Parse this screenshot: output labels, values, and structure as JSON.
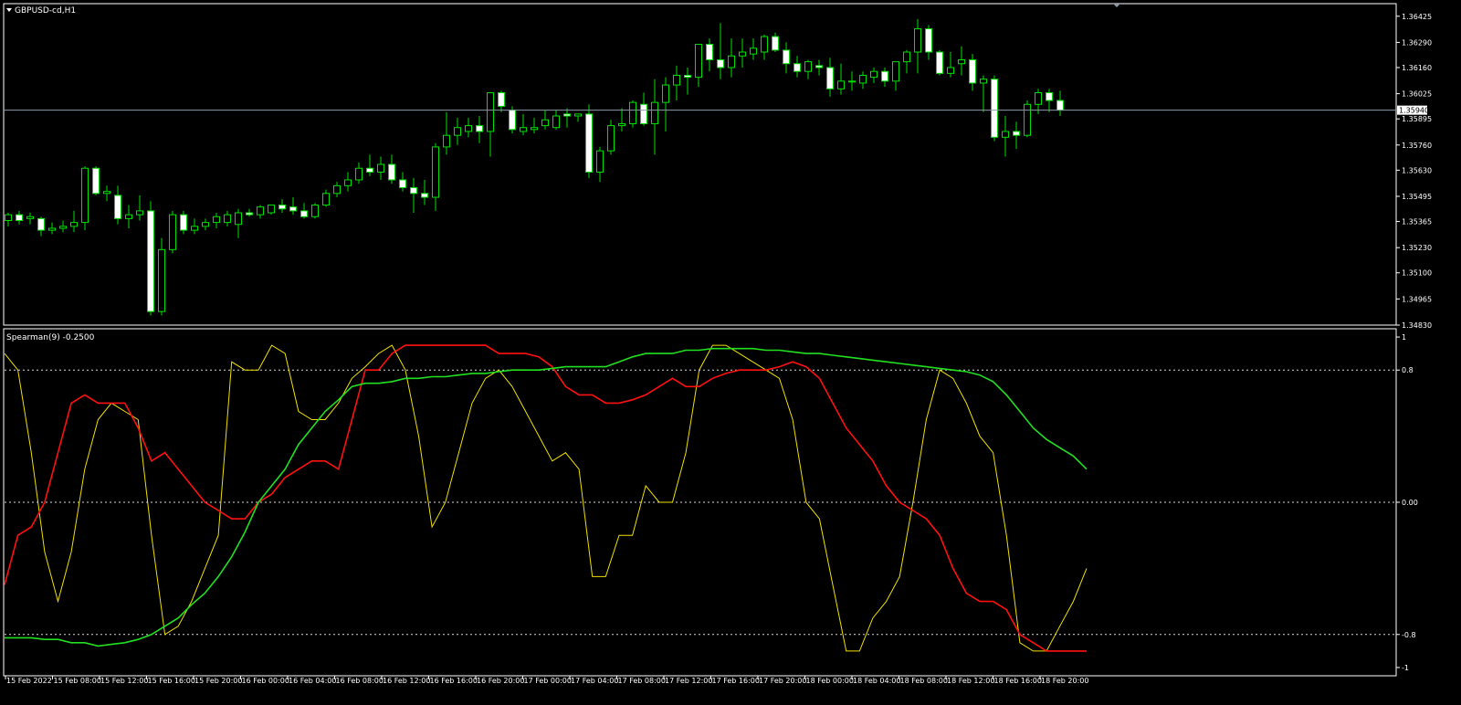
{
  "chart_data": [
    {
      "type": "candlestick",
      "title": "GBPUSD-cd,H1",
      "ylim": [
        1.3483,
        1.3649
      ],
      "y_ticks": [
        "1.36425",
        "1.36290",
        "1.36160",
        "1.36025",
        "1.35895",
        "1.35760",
        "1.35630",
        "1.35495",
        "1.35365",
        "1.35230",
        "1.35100",
        "1.34965",
        "1.34830"
      ],
      "current_price": 1.3594,
      "current_price_label": "1.35940",
      "candles": [
        [
          1.3537,
          1.3541,
          1.3534,
          1.354
        ],
        [
          1.354,
          1.3542,
          1.3535,
          1.3537
        ],
        [
          1.3538,
          1.3541,
          1.3535,
          1.3539
        ],
        [
          1.3538,
          1.3539,
          1.3529,
          1.3532
        ],
        [
          1.3532,
          1.3536,
          1.353,
          1.3533
        ],
        [
          1.3533,
          1.3537,
          1.3531,
          1.3534
        ],
        [
          1.3534,
          1.3542,
          1.3531,
          1.3536
        ],
        [
          1.3536,
          1.3565,
          1.3532,
          1.3564
        ],
        [
          1.3564,
          1.3565,
          1.355,
          1.3551
        ],
        [
          1.3551,
          1.3555,
          1.3547,
          1.3552
        ],
        [
          1.355,
          1.3555,
          1.3535,
          1.3538
        ],
        [
          1.3538,
          1.3545,
          1.3533,
          1.354
        ],
        [
          1.354,
          1.355,
          1.3537,
          1.3542
        ],
        [
          1.3542,
          1.3547,
          1.3488,
          1.349
        ],
        [
          1.349,
          1.3528,
          1.3488,
          1.3522
        ],
        [
          1.3522,
          1.3542,
          1.352,
          1.354
        ],
        [
          1.354,
          1.3542,
          1.353,
          1.3532
        ],
        [
          1.3532,
          1.3538,
          1.353,
          1.3534
        ],
        [
          1.3534,
          1.3538,
          1.3532,
          1.3536
        ],
        [
          1.3536,
          1.3541,
          1.3533,
          1.3539
        ],
        [
          1.3536,
          1.3542,
          1.3534,
          1.354
        ],
        [
          1.3535,
          1.3543,
          1.3528,
          1.3541
        ],
        [
          1.3541,
          1.3543,
          1.3539,
          1.354
        ],
        [
          1.354,
          1.3545,
          1.3538,
          1.3544
        ],
        [
          1.3541,
          1.3545,
          1.354,
          1.3545
        ],
        [
          1.3545,
          1.3548,
          1.3541,
          1.3543
        ],
        [
          1.3544,
          1.3549,
          1.354,
          1.3542
        ],
        [
          1.3542,
          1.3546,
          1.3538,
          1.3539
        ],
        [
          1.3539,
          1.3546,
          1.3538,
          1.3545
        ],
        [
          1.3545,
          1.3553,
          1.3544,
          1.3551
        ],
        [
          1.3551,
          1.3557,
          1.3549,
          1.3555
        ],
        [
          1.3555,
          1.3562,
          1.3552,
          1.3558
        ],
        [
          1.3558,
          1.3567,
          1.3556,
          1.3564
        ],
        [
          1.3564,
          1.3571,
          1.356,
          1.3562
        ],
        [
          1.3562,
          1.357,
          1.3558,
          1.3566
        ],
        [
          1.3566,
          1.3571,
          1.3556,
          1.3558
        ],
        [
          1.3558,
          1.3562,
          1.3552,
          1.3554
        ],
        [
          1.3554,
          1.3559,
          1.3541,
          1.3551
        ],
        [
          1.3551,
          1.3558,
          1.3545,
          1.3549
        ],
        [
          1.3549,
          1.3577,
          1.3542,
          1.3575
        ],
        [
          1.3575,
          1.3593,
          1.3571,
          1.3581
        ],
        [
          1.3581,
          1.359,
          1.3576,
          1.3585
        ],
        [
          1.3583,
          1.359,
          1.358,
          1.3586
        ],
        [
          1.3586,
          1.3591,
          1.3577,
          1.3583
        ],
        [
          1.3583,
          1.3597,
          1.357,
          1.3603
        ],
        [
          1.3603,
          1.3604,
          1.3593,
          1.3596
        ],
        [
          1.3594,
          1.3596,
          1.3582,
          1.3584
        ],
        [
          1.3583,
          1.3592,
          1.3581,
          1.3585
        ],
        [
          1.3584,
          1.359,
          1.3582,
          1.3585
        ],
        [
          1.3586,
          1.3594,
          1.3584,
          1.3589
        ],
        [
          1.3585,
          1.3594,
          1.3584,
          1.3591
        ],
        [
          1.3592,
          1.3595,
          1.3585,
          1.3591
        ],
        [
          1.3591,
          1.3592,
          1.3588,
          1.3592
        ],
        [
          1.3592,
          1.3597,
          1.3559,
          1.3562
        ],
        [
          1.3562,
          1.3575,
          1.3557,
          1.3573
        ],
        [
          1.3573,
          1.3589,
          1.3571,
          1.3586
        ],
        [
          1.3586,
          1.3595,
          1.3583,
          1.3587
        ],
        [
          1.3587,
          1.3599,
          1.3585,
          1.3598
        ],
        [
          1.3597,
          1.3603,
          1.3586,
          1.3587
        ],
        [
          1.3587,
          1.361,
          1.3571,
          1.3598
        ],
        [
          1.3598,
          1.3611,
          1.3583,
          1.3607
        ],
        [
          1.3607,
          1.3617,
          1.3599,
          1.3612
        ],
        [
          1.3612,
          1.3616,
          1.3602,
          1.3611
        ],
        [
          1.3611,
          1.3624,
          1.3606,
          1.3628
        ],
        [
          1.3628,
          1.3631,
          1.3614,
          1.362
        ],
        [
          1.362,
          1.3639,
          1.361,
          1.3616
        ],
        [
          1.3616,
          1.3631,
          1.3611,
          1.3622
        ],
        [
          1.3622,
          1.3631,
          1.3616,
          1.3624
        ],
        [
          1.3623,
          1.3631,
          1.362,
          1.3626
        ],
        [
          1.3624,
          1.3633,
          1.362,
          1.3632
        ],
        [
          1.3632,
          1.3634,
          1.3624,
          1.3625
        ],
        [
          1.3625,
          1.3629,
          1.3613,
          1.3618
        ],
        [
          1.3618,
          1.3622,
          1.3611,
          1.3614
        ],
        [
          1.3614,
          1.362,
          1.361,
          1.3619
        ],
        [
          1.3617,
          1.362,
          1.3612,
          1.3616
        ],
        [
          1.3616,
          1.3621,
          1.3601,
          1.3605
        ],
        [
          1.3605,
          1.3618,
          1.3602,
          1.3609
        ],
        [
          1.3609,
          1.3614,
          1.3604,
          1.3609
        ],
        [
          1.3608,
          1.3614,
          1.3605,
          1.3612
        ],
        [
          1.3611,
          1.3616,
          1.3608,
          1.3614
        ],
        [
          1.3614,
          1.3616,
          1.3606,
          1.3609
        ],
        [
          1.3609,
          1.3618,
          1.3604,
          1.3619
        ],
        [
          1.3619,
          1.3625,
          1.3613,
          1.3624
        ],
        [
          1.3624,
          1.3641,
          1.3613,
          1.3636
        ],
        [
          1.3636,
          1.3638,
          1.362,
          1.3624
        ],
        [
          1.3624,
          1.3625,
          1.3612,
          1.3613
        ],
        [
          1.3613,
          1.3624,
          1.3611,
          1.3616
        ],
        [
          1.3618,
          1.3627,
          1.3612,
          1.362
        ],
        [
          1.362,
          1.3623,
          1.3604,
          1.3608
        ],
        [
          1.3608,
          1.3612,
          1.3593,
          1.361
        ],
        [
          1.361,
          1.3612,
          1.3578,
          1.358
        ],
        [
          1.358,
          1.3591,
          1.357,
          1.3583
        ],
        [
          1.3583,
          1.3588,
          1.3574,
          1.3581
        ],
        [
          1.3581,
          1.3599,
          1.358,
          1.3597
        ],
        [
          1.3597,
          1.3605,
          1.3592,
          1.3603
        ],
        [
          1.3603,
          1.3605,
          1.3593,
          1.3599
        ],
        [
          1.3599,
          1.3604,
          1.3591,
          1.3594
        ]
      ],
      "x_labels": [
        "15 Feb 2022",
        "15 Feb 08:00",
        "15 Feb 12:00",
        "15 Feb 16:00",
        "15 Feb 20:00",
        "16 Feb 00:00",
        "16 Feb 04:00",
        "16 Feb 08:00",
        "16 Feb 12:00",
        "16 Feb 16:00",
        "16 Feb 20:00",
        "17 Feb 00:00",
        "17 Feb 04:00",
        "17 Feb 08:00",
        "17 Feb 12:00",
        "17 Feb 16:00",
        "17 Feb 20:00",
        "18 Feb 00:00",
        "18 Feb 04:00",
        "18 Feb 08:00",
        "18 Feb 12:00",
        "18 Feb 16:00",
        "18 Feb 20:00"
      ],
      "colors": {
        "bull_body": "#000000",
        "bear_body": "#ffffff",
        "wick": "#00e000",
        "price_line": "#8f9aa8",
        "grid": "#ffffff"
      }
    },
    {
      "type": "line",
      "title": "Spearman(9) -0.2500",
      "ylim": [
        -1.05,
        1.05
      ],
      "y_ticks": [
        "1",
        "0.8",
        "0.00",
        "-0.8",
        "-1"
      ],
      "y_tick_values": [
        1,
        0.8,
        0,
        -0.8,
        -1
      ],
      "levels": [
        0.8,
        0,
        -0.8
      ],
      "x_labels": [
        "15 Feb 2022",
        "15 Feb 08:00",
        "15 Feb 12:00",
        "15 Feb 16:00",
        "15 Feb 20:00",
        "16 Feb 00:00",
        "16 Feb 04:00",
        "16 Feb 08:00",
        "16 Feb 12:00",
        "16 Feb 16:00",
        "16 Feb 20:00",
        "17 Feb 00:00",
        "17 Feb 04:00",
        "17 Feb 08:00",
        "17 Feb 12:00",
        "17 Feb 16:00",
        "17 Feb 20:00",
        "18 Feb 00:00",
        "18 Feb 04:00",
        "18 Feb 08:00",
        "18 Feb 12:00",
        "18 Feb 16:00",
        "18 Feb 20:00"
      ],
      "series": [
        {
          "color": "#f0e000",
          "values": [
            0.9,
            0.8,
            0.3,
            -0.3,
            -0.6,
            -0.3,
            0.2,
            0.5,
            0.6,
            0.55,
            0.5,
            -0.2,
            -0.8,
            -0.75,
            -0.6,
            -0.4,
            -0.2,
            0.85,
            0.8,
            0.8,
            0.95,
            0.9,
            0.55,
            0.5,
            0.5,
            0.6,
            0.75,
            0.82,
            0.9,
            0.95,
            0.8,
            0.4,
            -0.15,
            0.0,
            0.3,
            0.6,
            0.75,
            0.8,
            0.7,
            0.55,
            0.4,
            0.25,
            0.3,
            0.2,
            -0.45,
            -0.45,
            -0.2,
            -0.2,
            0.1,
            0.0,
            0.0,
            0.3,
            0.8,
            0.95,
            0.95,
            0.9,
            0.85,
            0.8,
            0.75,
            0.5,
            0.0,
            -0.1,
            -0.5,
            -0.9,
            -0.9,
            -0.7,
            -0.6,
            -0.45,
            0.0,
            0.5,
            0.8,
            0.75,
            0.6,
            0.4,
            0.3,
            -0.2,
            -0.85,
            -0.9,
            -0.9,
            -0.75,
            -0.6,
            -0.4
          ]
        },
        {
          "color": "#ff1010",
          "values": [
            -0.5,
            -0.2,
            -0.15,
            0.0,
            0.3,
            0.6,
            0.65,
            0.6,
            0.6,
            0.6,
            0.45,
            0.25,
            0.3,
            0.2,
            0.1,
            0.0,
            -0.05,
            -0.1,
            -0.1,
            0.0,
            0.05,
            0.15,
            0.2,
            0.25,
            0.25,
            0.2,
            0.5,
            0.8,
            0.8,
            0.9,
            0.95,
            0.95,
            0.95,
            0.95,
            0.95,
            0.95,
            0.95,
            0.9,
            0.9,
            0.9,
            0.88,
            0.82,
            0.7,
            0.65,
            0.65,
            0.6,
            0.6,
            0.62,
            0.65,
            0.7,
            0.75,
            0.7,
            0.7,
            0.75,
            0.78,
            0.8,
            0.8,
            0.8,
            0.82,
            0.85,
            0.82,
            0.75,
            0.6,
            0.45,
            0.35,
            0.25,
            0.1,
            0.0,
            -0.05,
            -0.1,
            -0.2,
            -0.4,
            -0.55,
            -0.6,
            -0.6,
            -0.65,
            -0.8,
            -0.85,
            -0.9,
            -0.9,
            -0.9,
            -0.9
          ]
        },
        {
          "color": "#20e020",
          "values": [
            -0.82,
            -0.82,
            -0.82,
            -0.83,
            -0.83,
            -0.85,
            -0.85,
            -0.87,
            -0.86,
            -0.85,
            -0.83,
            -0.8,
            -0.75,
            -0.7,
            -0.62,
            -0.55,
            -0.45,
            -0.33,
            -0.18,
            0.0,
            0.1,
            0.2,
            0.35,
            0.45,
            0.55,
            0.62,
            0.7,
            0.72,
            0.72,
            0.73,
            0.75,
            0.75,
            0.76,
            0.76,
            0.77,
            0.78,
            0.78,
            0.79,
            0.8,
            0.8,
            0.8,
            0.81,
            0.82,
            0.82,
            0.82,
            0.82,
            0.85,
            0.88,
            0.9,
            0.9,
            0.9,
            0.92,
            0.92,
            0.93,
            0.93,
            0.93,
            0.93,
            0.92,
            0.92,
            0.91,
            0.9,
            0.9,
            0.89,
            0.88,
            0.87,
            0.86,
            0.85,
            0.84,
            0.83,
            0.82,
            0.81,
            0.8,
            0.79,
            0.77,
            0.73,
            0.65,
            0.55,
            0.45,
            0.38,
            0.33,
            0.28,
            0.2
          ]
        }
      ],
      "colors": {
        "level_line": "#d8d8d8",
        "grid": "#ffffff"
      }
    }
  ]
}
